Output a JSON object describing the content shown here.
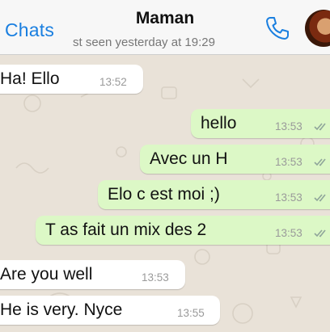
{
  "header": {
    "back_label": "Chats",
    "contact_name": "Maman",
    "status": "st seen yesterday at 19:29"
  },
  "colors": {
    "accent": "#1a7fe0",
    "incoming_bubble": "#ffffff",
    "outgoing_bubble": "#dcf8c6",
    "read_ticks": "#8fa59a",
    "wallpaper": "#e9e2d8"
  },
  "messages": [
    {
      "direction": "incoming",
      "text": "Ha! Ello",
      "time": "13:52"
    },
    {
      "direction": "outgoing",
      "text": "hello",
      "time": "13:53",
      "status": "read-ticks-icon"
    },
    {
      "direction": "outgoing",
      "text": "Avec un H",
      "time": "13:53",
      "status": "read-ticks-icon"
    },
    {
      "direction": "outgoing",
      "text": "Elo c est moi ;)",
      "time": "13:53",
      "status": "read-ticks-icon"
    },
    {
      "direction": "outgoing",
      "text": "T as fait un mix des 2",
      "time": "13:53",
      "status": "read-ticks-icon"
    },
    {
      "direction": "incoming",
      "text": "Are you well",
      "time": "13:53"
    },
    {
      "direction": "incoming",
      "text": "He is very. Nyce",
      "time": "13:55"
    }
  ]
}
